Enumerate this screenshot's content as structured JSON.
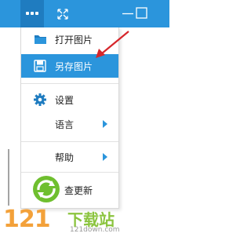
{
  "titlebar": {
    "buttons": [
      "more",
      "expand",
      "minimize",
      "maximize"
    ],
    "accent": "#2b95dc"
  },
  "menu": {
    "items": [
      {
        "label": "打开图片",
        "icon": "folder-icon"
      },
      {
        "label": "另存图片",
        "icon": "save-icon",
        "selected": true
      },
      {
        "label": "设置",
        "icon": "gear-icon"
      },
      {
        "label": "语言",
        "submenu": true
      },
      {
        "label": "帮助",
        "submenu": true
      }
    ],
    "partial_item": "查更新"
  },
  "watermark": {
    "number": "121",
    "cn": "下载站",
    "url": "121down.com"
  }
}
